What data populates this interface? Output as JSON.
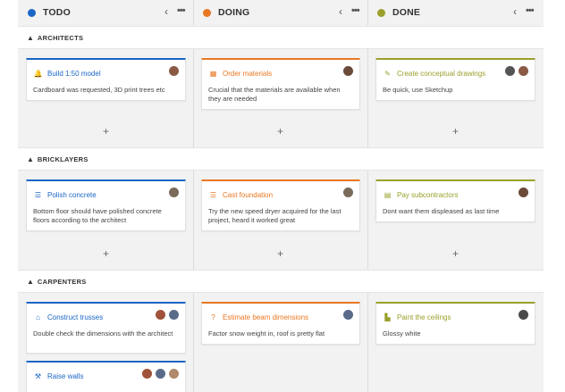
{
  "colors": {
    "todo": "#1a66c4",
    "doing": "#e87722",
    "done": "#9aa02a"
  },
  "columns": [
    {
      "title": "TODO",
      "collapse_icon": "chevron-left-icon",
      "menu_icon": "more-horizontal-icon"
    },
    {
      "title": "DOING",
      "collapse_icon": "chevron-left-icon",
      "menu_icon": "more-horizontal-icon"
    },
    {
      "title": "DONE",
      "collapse_icon": "chevron-left-icon",
      "menu_icon": "more-horizontal-icon"
    }
  ],
  "glyphs": {
    "chevron_left": "‹",
    "more": "•••",
    "caret_up": "▲",
    "plus": "+"
  },
  "groups": [
    {
      "name": "ARCHITECTS",
      "cards": {
        "todo": [
          {
            "title": "Build 1:50 model",
            "desc": "Cardboard was requested, 3D print trees etc",
            "icon": "bell-icon",
            "glyph": "🔔"
          }
        ],
        "doing": [
          {
            "title": "Order materials",
            "desc": "Crucial that the materials are available when they are needed",
            "icon": "calendar-icon",
            "glyph": "▦"
          }
        ],
        "done": [
          {
            "title": "Create conceptual drawings",
            "desc": "Be quick, use Sketchup",
            "icon": "pencil-icon",
            "glyph": "✎"
          }
        ]
      }
    },
    {
      "name": "BRICKLAYERS",
      "cards": {
        "todo": [
          {
            "title": "Polish concrete",
            "desc": "Bottom floor should have polished concrete floors according to the architect",
            "icon": "list-icon",
            "glyph": "☰"
          }
        ],
        "doing": [
          {
            "title": "Cast foundation",
            "desc": "Try the new speed dryer acquired for the last project, heard it worked great",
            "icon": "list-icon",
            "glyph": "☰"
          }
        ],
        "done": [
          {
            "title": "Pay subcontractors",
            "desc": "Dont want them displeased as last time",
            "icon": "money-icon",
            "glyph": "▤"
          }
        ]
      }
    },
    {
      "name": "CARPENTERS",
      "cards": {
        "todo": [
          {
            "title": "Construct trusses",
            "desc": "Double check the dimensions with the architect",
            "icon": "home-icon",
            "glyph": "⌂"
          },
          {
            "title": "Raise walls",
            "desc": "",
            "icon": "hammer-icon",
            "glyph": "⚒"
          }
        ],
        "doing": [
          {
            "title": "Estimate beam dimensions",
            "desc": "Factor snow weight in, roof is pretty flat",
            "icon": "question-icon",
            "glyph": "?"
          }
        ],
        "done": [
          {
            "title": "Paint the ceilings",
            "desc": "Glossy white",
            "icon": "paint-roller-icon",
            "glyph": "▙"
          }
        ]
      }
    }
  ]
}
